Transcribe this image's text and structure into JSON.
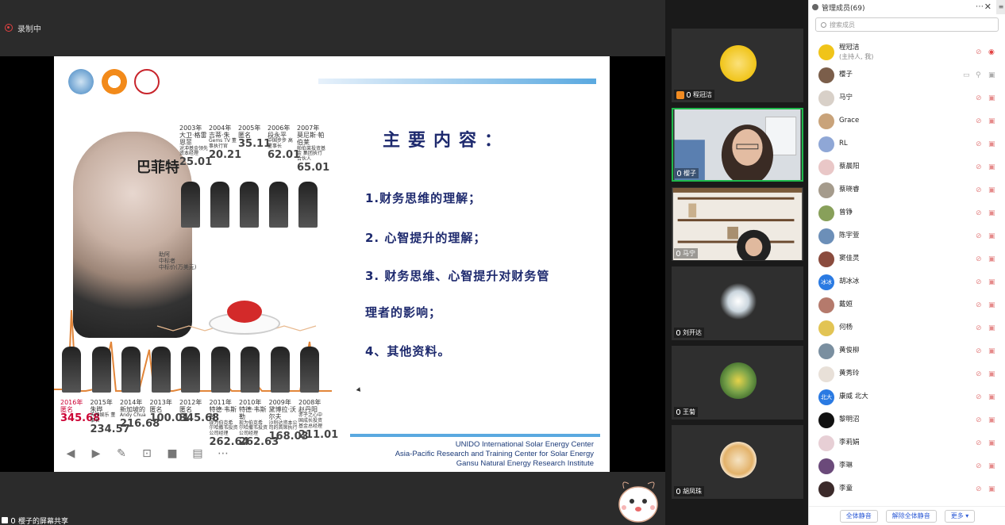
{
  "recording": {
    "label": "录制中"
  },
  "share_label": "樱子的屏幕共享",
  "slide": {
    "buffett_title": "巴菲特",
    "donor_note": [
      "助阿",
      "中标者",
      "中标价(万美元)"
    ],
    "top_years": [
      {
        "year": "2003年",
        "who": "大卫·格雷恩菲",
        "desc": "对冲基金领先 资本经理",
        "price": "25.01"
      },
      {
        "year": "2004年",
        "who": "吉蒂·朱",
        "desc": "Gems TV 董事执行官",
        "price": "20.21"
      },
      {
        "year": "2005年",
        "who": "匿名",
        "desc": "",
        "price": "35.11"
      },
      {
        "year": "2006年",
        "who": "段永平",
        "desc": "中国步步 高董事长",
        "price": "62.01"
      },
      {
        "year": "2007年",
        "who": "莫尼斯·帕伯莱",
        "desc": "帕伯莱投资基金 集团执行合伙人",
        "price": "65.01"
      }
    ],
    "bottom_years": [
      {
        "year": "2016年",
        "who": "匿名",
        "desc": "",
        "price": "345.68",
        "red": true
      },
      {
        "year": "2015年",
        "who": "朱晔",
        "desc": "天神娱乐 董事长",
        "price": "234.57"
      },
      {
        "year": "2014年",
        "who": "新加坡的",
        "desc": "Andy Chua",
        "price": "216.68"
      },
      {
        "year": "2013年",
        "who": "匿名",
        "desc": "",
        "price": "100.01"
      },
      {
        "year": "2012年",
        "who": "匿名",
        "desc": "",
        "price": "345.68"
      },
      {
        "year": "2011年",
        "who": "特德·韦斯勒",
        "desc": "现为伯克希 尔哈撒韦投资 公司经理",
        "price": "262.64"
      },
      {
        "year": "2010年",
        "who": "特德·韦斯勒",
        "desc": "现为伯克希 尔哈撒韦投资 公司经理",
        "price": "262.63"
      },
      {
        "year": "2009年",
        "who": "黛博拉·沃尔夫",
        "desc": "沙利达资本公 司的首席执行",
        "price": "168.03"
      },
      {
        "year": "2008年",
        "who": "赵丹阳",
        "desc": "赤子之心中 国成长投资 基金总经理",
        "price": "211.01"
      }
    ],
    "title": "主要内容：",
    "points": [
      "1.财务思维的理解；",
      "2. 心智提升的理解；",
      "3. 财务思维、心智提升对财务管",
      "理者的影响；",
      "4、其他资料。"
    ],
    "footer": [
      "UNIDO International Solar Energy Center",
      "Asia-Pacific Research and Training Center for Solar Energy",
      "Gansu Natural Energy Research Institute"
    ],
    "logos": [
      "UNIDO-ISEC",
      "GNERI",
      ""
    ]
  },
  "videos": [
    {
      "name": "程冠洁",
      "host": true
    },
    {
      "name": "樱子",
      "active": true
    },
    {
      "name": "马宁"
    },
    {
      "name": "刘开达"
    },
    {
      "name": "王菊"
    },
    {
      "name": "胡凤珠"
    }
  ],
  "panel": {
    "title": "管理成员(69)",
    "search_placeholder": "搜索成员",
    "members": [
      {
        "name": "程冠洁",
        "sub": "(主持人, 我)",
        "color": "#f0c419"
      },
      {
        "name": "樱子",
        "color": "#7b5e4a"
      },
      {
        "name": "马宁",
        "color": "#d8d0c8"
      },
      {
        "name": "Grace",
        "color": "#c9a37a"
      },
      {
        "name": "RL",
        "color": "#8fa7d6"
      },
      {
        "name": "蔡晨阳",
        "color": "#e9c7c7"
      },
      {
        "name": "蔡晓睿",
        "color": "#a59b8c"
      },
      {
        "name": "曾铮",
        "color": "#88a05a"
      },
      {
        "name": "陈宇萱",
        "color": "#6c8fb8"
      },
      {
        "name": "窦佳灵",
        "color": "#8a4b3d"
      },
      {
        "name": "胡冰冰",
        "color": "#2a7ae2",
        "initials": "冰冰"
      },
      {
        "name": "戴姮",
        "color": "#b57a6c"
      },
      {
        "name": "何杨",
        "color": "#e2c454"
      },
      {
        "name": "黄俊柳",
        "color": "#7a8fa0"
      },
      {
        "name": "黄秀玲",
        "color": "#e8e0d8"
      },
      {
        "name": "康威 北大",
        "color": "#2a7ae2",
        "initials": "北大"
      },
      {
        "name": "黎明沼",
        "color": "#111111"
      },
      {
        "name": "李莉娟",
        "color": "#e7cfd5"
      },
      {
        "name": "李琳",
        "color": "#6b4a7a"
      },
      {
        "name": "李童",
        "color": "#3b2a2a"
      }
    ],
    "buttons": [
      "全体静音",
      "解除全体静音",
      "更多 ▾"
    ]
  }
}
